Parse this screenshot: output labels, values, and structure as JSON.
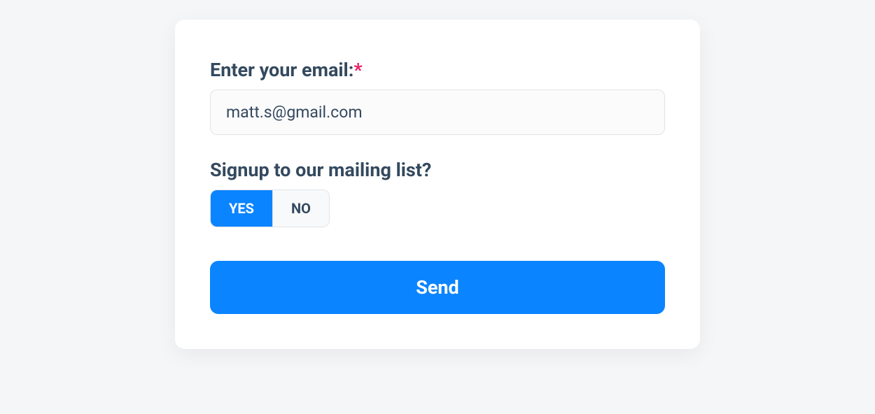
{
  "form": {
    "email": {
      "label": "Enter your email:",
      "required_marker": "*",
      "value": "matt.s@gmail.com"
    },
    "mailing": {
      "label": "Signup to our mailing list?",
      "options": {
        "yes": "YES",
        "no": "NO"
      },
      "selected": "yes"
    },
    "submit_label": "Send"
  },
  "colors": {
    "accent": "#0b84ff",
    "required": "#e91e63",
    "text": "#34495e"
  }
}
